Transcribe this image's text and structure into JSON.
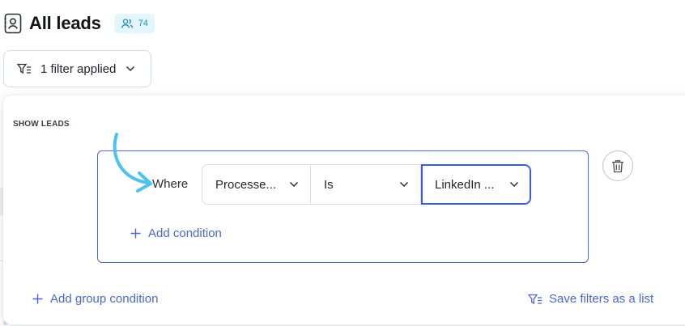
{
  "header": {
    "title": "All leads",
    "lead_count": "74",
    "contact_icon": "contact-card-icon",
    "users_icon": "users-icon"
  },
  "filter_toggle": {
    "label": "1 filter applied",
    "icon": "filter-icon"
  },
  "panel": {
    "section_label": "SHOW LEADS",
    "condition": {
      "where_label": "Where",
      "field": "Processe...",
      "operator": "Is",
      "value": "LinkedIn ..."
    },
    "add_condition_label": "Add condition",
    "add_group_label": "Add group condition",
    "save_list_label": "Save filters as a list"
  },
  "colors": {
    "accent_blue": "#4a68cf",
    "focus_border": "#3b5bdb",
    "badge_bg": "#e3f6fb",
    "badge_text": "#1f8fb3",
    "annotation_arrow": "#4cc3ee"
  }
}
